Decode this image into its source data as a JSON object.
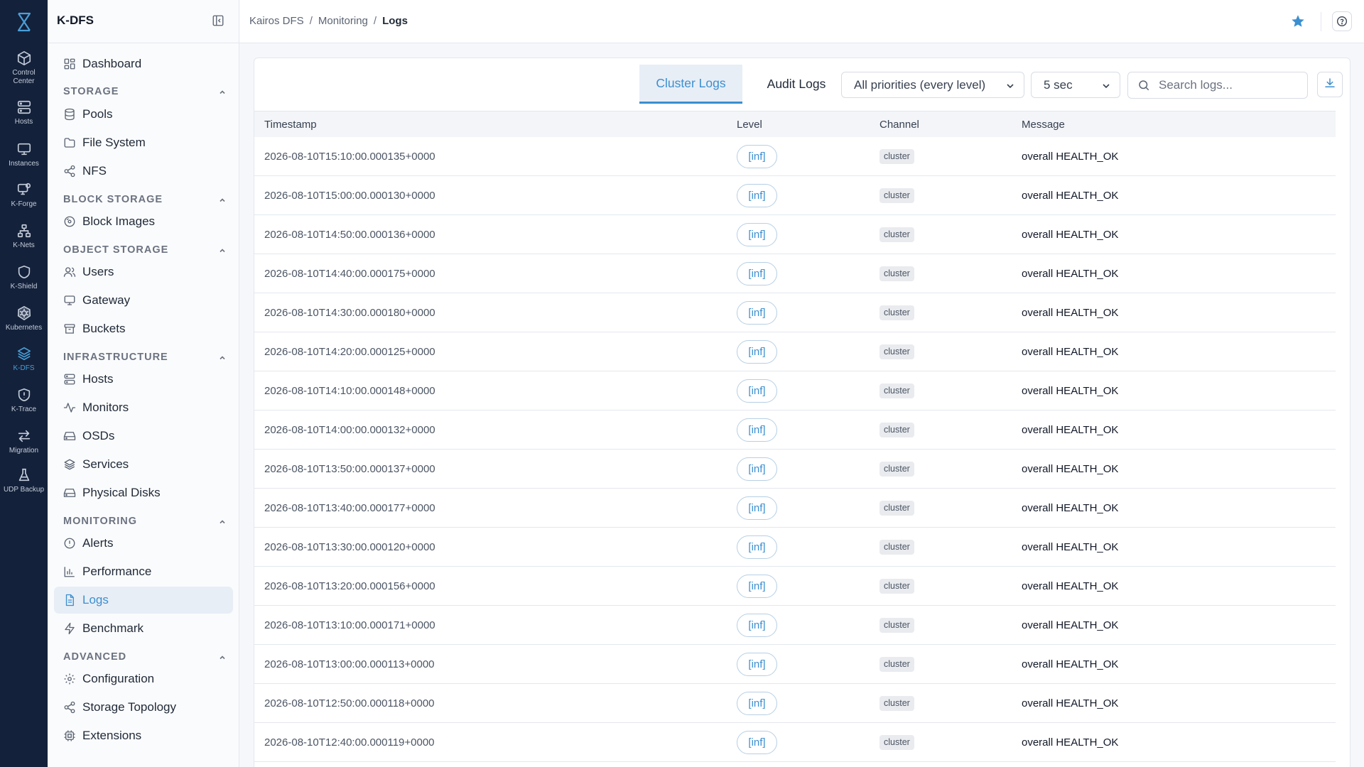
{
  "colors": {
    "rail_bg": "#14213a",
    "accent": "#3b8fd0",
    "active_bg": "#e8eef6",
    "star": "#3b8fd0"
  },
  "rail": {
    "items": [
      {
        "label": "Control Center",
        "icon": "cube-icon"
      },
      {
        "label": "Hosts",
        "icon": "server-icon"
      },
      {
        "label": "Instances",
        "icon": "monitor-icon"
      },
      {
        "label": "K-Forge",
        "icon": "forge-icon"
      },
      {
        "label": "K-Nets",
        "icon": "network-icon"
      },
      {
        "label": "K-Shield",
        "icon": "shield-icon"
      },
      {
        "label": "Kubernetes",
        "icon": "helm-wheel-icon"
      },
      {
        "label": "K-DFS",
        "icon": "layers-icon"
      },
      {
        "label": "K-Trace",
        "icon": "trace-shield-icon"
      },
      {
        "label": "Migration",
        "icon": "swap-arrows-icon"
      },
      {
        "label": "UDP Backup",
        "icon": "flask-icon"
      }
    ]
  },
  "sidebar": {
    "title": "K-DFS",
    "dashboard": "Dashboard",
    "sections": {
      "storage": {
        "label": "STORAGE",
        "items": [
          "Pools",
          "File System",
          "NFS"
        ]
      },
      "block_storage": {
        "label": "BLOCK STORAGE",
        "items": [
          "Block Images"
        ]
      },
      "object_storage": {
        "label": "OBJECT STORAGE",
        "items": [
          "Users",
          "Gateway",
          "Buckets"
        ]
      },
      "infrastructure": {
        "label": "INFRASTRUCTURE",
        "items": [
          "Hosts",
          "Monitors",
          "OSDs",
          "Services",
          "Physical Disks"
        ]
      },
      "monitoring": {
        "label": "MONITORING",
        "items": [
          "Alerts",
          "Performance",
          "Logs",
          "Benchmark"
        ]
      },
      "advanced": {
        "label": "ADVANCED",
        "items": [
          "Configuration",
          "Storage Topology",
          "Extensions"
        ]
      }
    }
  },
  "breadcrumb": {
    "items": [
      "Kairos DFS",
      "Monitoring"
    ],
    "current": "Logs"
  },
  "tabs": {
    "cluster": "Cluster Logs",
    "audit": "Audit Logs"
  },
  "filters": {
    "priority": "All priorities (every level)",
    "refresh": "5 sec"
  },
  "search": {
    "placeholder": "Search logs...",
    "value": ""
  },
  "table": {
    "columns": [
      "Timestamp",
      "Level",
      "Channel",
      "Message"
    ],
    "rows": [
      {
        "timestamp": "2026-08-10T15:10:00.000135+0000",
        "level": "[inf]",
        "channel": "cluster",
        "message": "overall HEALTH_OK"
      },
      {
        "timestamp": "2026-08-10T15:00:00.000130+0000",
        "level": "[inf]",
        "channel": "cluster",
        "message": "overall HEALTH_OK"
      },
      {
        "timestamp": "2026-08-10T14:50:00.000136+0000",
        "level": "[inf]",
        "channel": "cluster",
        "message": "overall HEALTH_OK"
      },
      {
        "timestamp": "2026-08-10T14:40:00.000175+0000",
        "level": "[inf]",
        "channel": "cluster",
        "message": "overall HEALTH_OK"
      },
      {
        "timestamp": "2026-08-10T14:30:00.000180+0000",
        "level": "[inf]",
        "channel": "cluster",
        "message": "overall HEALTH_OK"
      },
      {
        "timestamp": "2026-08-10T14:20:00.000125+0000",
        "level": "[inf]",
        "channel": "cluster",
        "message": "overall HEALTH_OK"
      },
      {
        "timestamp": "2026-08-10T14:10:00.000148+0000",
        "level": "[inf]",
        "channel": "cluster",
        "message": "overall HEALTH_OK"
      },
      {
        "timestamp": "2026-08-10T14:00:00.000132+0000",
        "level": "[inf]",
        "channel": "cluster",
        "message": "overall HEALTH_OK"
      },
      {
        "timestamp": "2026-08-10T13:50:00.000137+0000",
        "level": "[inf]",
        "channel": "cluster",
        "message": "overall HEALTH_OK"
      },
      {
        "timestamp": "2026-08-10T13:40:00.000177+0000",
        "level": "[inf]",
        "channel": "cluster",
        "message": "overall HEALTH_OK"
      },
      {
        "timestamp": "2026-08-10T13:30:00.000120+0000",
        "level": "[inf]",
        "channel": "cluster",
        "message": "overall HEALTH_OK"
      },
      {
        "timestamp": "2026-08-10T13:20:00.000156+0000",
        "level": "[inf]",
        "channel": "cluster",
        "message": "overall HEALTH_OK"
      },
      {
        "timestamp": "2026-08-10T13:10:00.000171+0000",
        "level": "[inf]",
        "channel": "cluster",
        "message": "overall HEALTH_OK"
      },
      {
        "timestamp": "2026-08-10T13:00:00.000113+0000",
        "level": "[inf]",
        "channel": "cluster",
        "message": "overall HEALTH_OK"
      },
      {
        "timestamp": "2026-08-10T12:50:00.000118+0000",
        "level": "[inf]",
        "channel": "cluster",
        "message": "overall HEALTH_OK"
      },
      {
        "timestamp": "2026-08-10T12:40:00.000119+0000",
        "level": "[inf]",
        "channel": "cluster",
        "message": "overall HEALTH_OK"
      }
    ]
  }
}
